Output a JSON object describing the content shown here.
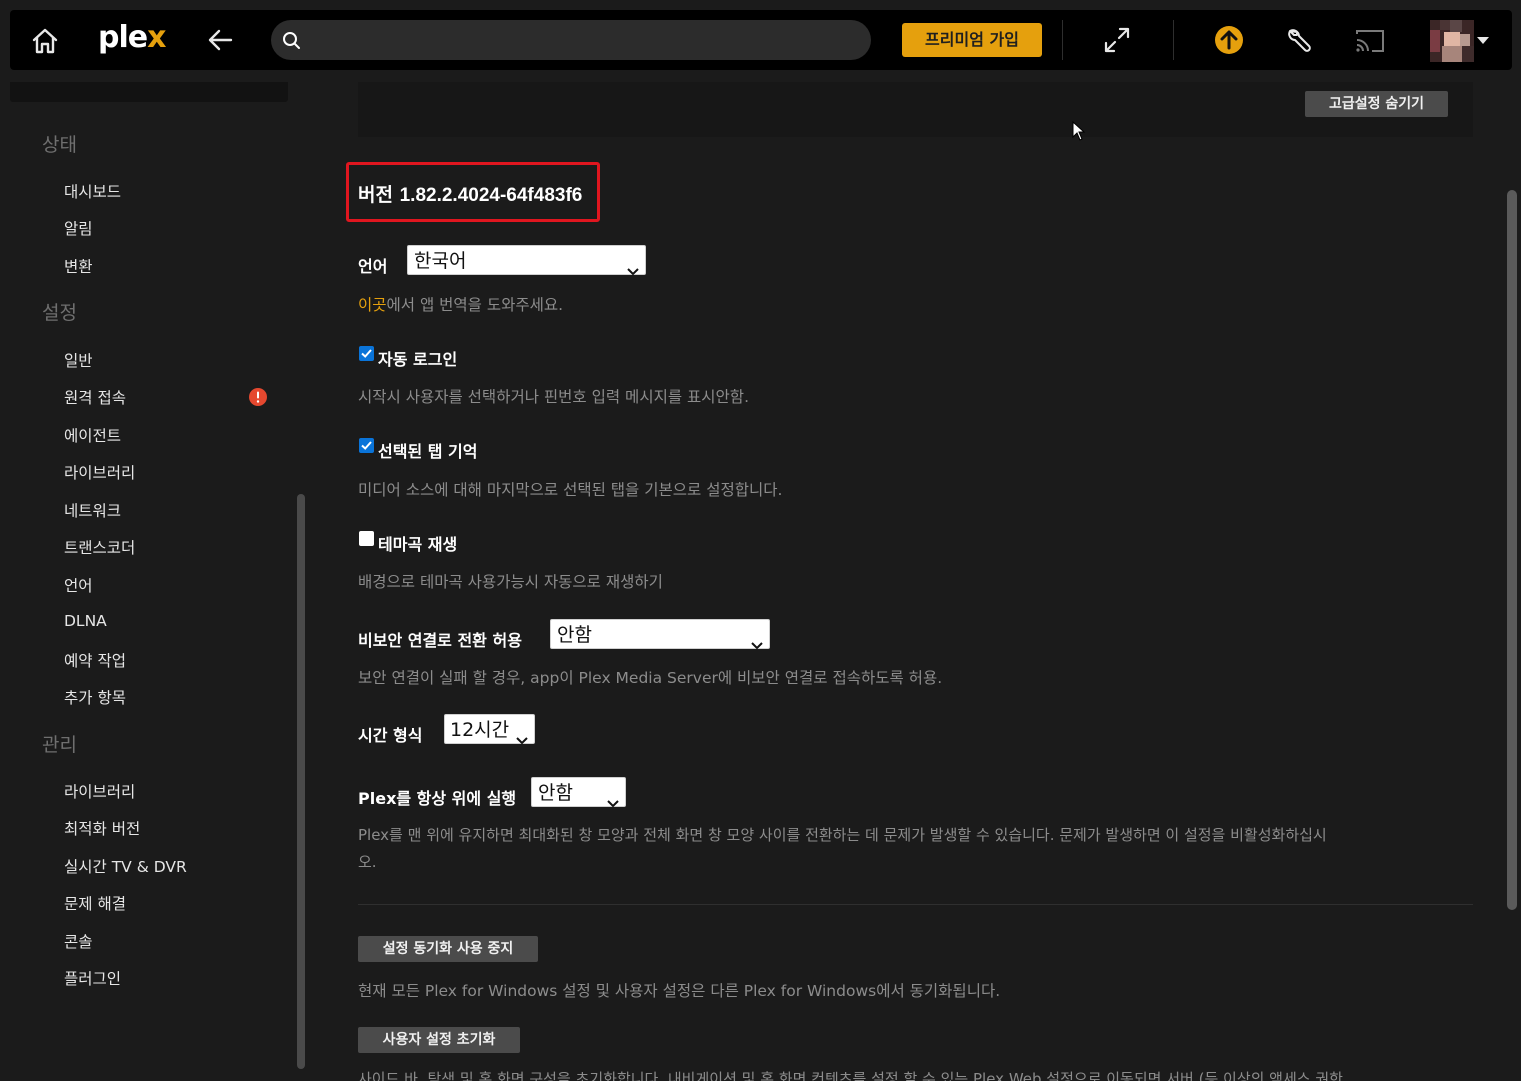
{
  "topbar": {
    "logo_main": "ple",
    "logo_x": "x",
    "search_placeholder": "",
    "premium_label": "프리미엄 가입"
  },
  "sidebar": {
    "sections": [
      {
        "title": "상태",
        "items": [
          "대시보드",
          "알림",
          "변환"
        ]
      },
      {
        "title": "설정",
        "items": [
          "일반",
          "원격 접속",
          "에이전트",
          "라이브러리",
          "네트워크",
          "트랜스코더",
          "언어",
          "DLNA",
          "예약 작업",
          "추가 항목"
        ]
      },
      {
        "title": "관리",
        "items": [
          "라이브러리",
          "최적화 버전",
          "실시간 TV & DVR",
          "문제 해결",
          "콘솔",
          "플러그인"
        ]
      }
    ],
    "warning_on": "원격 접속",
    "warning_color": "#e5482f"
  },
  "main": {
    "advanced_button": "고급설정 숨기기",
    "version_prefix": "버전",
    "version_value": "1.82.2.4024-64f483f6",
    "highlight_color": "#e0161f",
    "language": {
      "label": "언어",
      "value": "한국어",
      "desc_link": "이곳",
      "desc_rest": "에서 앱 번역을 도와주세요."
    },
    "auto_login": {
      "label": "자동 로그인",
      "checked": true,
      "desc": "시작시 사용자를 선택하거나 핀번호 입력 메시지를 표시안함."
    },
    "remember_tab": {
      "label": "선택된 탭 기억",
      "checked": true,
      "desc": "미디어 소스에 대해 마지막으로 선택된 탭을 기본으로 설정합니다."
    },
    "theme_music": {
      "label": "테마곡 재생",
      "checked": false,
      "desc": "배경으로 테마곡 사용가능시 자동으로 재생하기"
    },
    "insecure": {
      "label": "비보안 연결로 전환 허용",
      "value": "안함",
      "desc": "보안 연결이 실패 할 경우, app이 Plex Media Server에 비보안 연결로 접속하도록 허용."
    },
    "time_format": {
      "label": "시간 형식",
      "value": "12시간"
    },
    "always_on_top": {
      "label": "Plex를 항상 위에 실행",
      "value": "안함",
      "desc_line1": "Plex를 맨 위에 유지하면 최대화된 창 모양과 전체 화면 창 모양 사이를 전환하는 데 문제가 발생할 수 있습니다. 문제가 발생하면 이 설정을 비활성화하십시",
      "desc_line2": "오."
    },
    "sync_button": "설정 동기화 사용 중지",
    "sync_desc": "현재 모든 Plex for Windows 설정 및 사용자 설정은 다른 Plex for Windows에서 동기화됩니다.",
    "reset_button": "사용자 설정 초기화",
    "reset_desc": "사이드 바, 탐색 및 홈 화면 구성을 초기화합니다. 내비게이션 및 홈 화면 컨텐츠를 설정 할 수 있는 Plex Web 설정으로 이동되면 서버 (등 이상의 액세스 권한"
  },
  "colors": {
    "accent": "#e5a00d",
    "checkbox_on": "#0a74d9"
  }
}
